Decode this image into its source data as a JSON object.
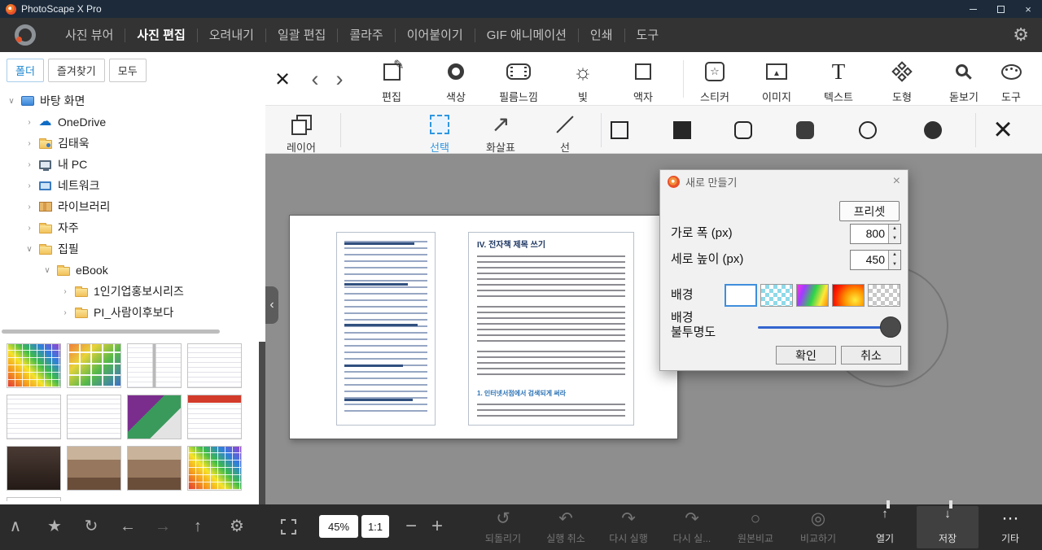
{
  "titlebar": {
    "title": "PhotoScape X Pro"
  },
  "icons": {
    "close": "×",
    "back": "‹",
    "forward": "›",
    "pencil": "✎",
    "sun": "☼",
    "star_outline": "☆",
    "star": "★",
    "text_t": "T",
    "arrow_ne": "↗",
    "cloud": "☁",
    "chevron_up": "∧",
    "refresh": "↻",
    "arrow_left": "←",
    "arrow_right": "→",
    "arrow_up": "↑",
    "arrow_down": "↓",
    "gear": "⚙",
    "undo_full": "↺",
    "undo": "↶",
    "redo": "↷",
    "circle": "○",
    "circle_double": "◎",
    "more": "⋯",
    "spin_up": "▲",
    "spin_down": "▼",
    "minus": "−",
    "plus": "+",
    "mountain": "▲"
  },
  "menubar": {
    "items": [
      "사진 뷰어",
      "사진 편집",
      "오려내기",
      "일괄 편집",
      "콜라주",
      "이어붙이기",
      "GIF 애니메이션",
      "인쇄",
      "도구"
    ],
    "active_item": "사진 편집"
  },
  "sidebar": {
    "tabs": [
      "폴더",
      "즐겨찾기",
      "모두"
    ],
    "active_tab": "폴더",
    "tree": [
      {
        "chevron": "∨",
        "label": "바탕 화면"
      },
      {
        "chevron": "›",
        "label": "OneDrive"
      },
      {
        "chevron": "›",
        "label": "김태욱"
      },
      {
        "chevron": "›",
        "label": "내 PC"
      },
      {
        "chevron": "›",
        "label": "네트워크"
      },
      {
        "chevron": "›",
        "label": "라이브러리"
      },
      {
        "chevron": "›",
        "label": "자주"
      },
      {
        "chevron": "∨",
        "label": "집필"
      },
      {
        "chevron": "∨",
        "label": "eBook"
      },
      {
        "chevron": "›",
        "label": "1인기업홍보시리즈"
      },
      {
        "chevron": "›",
        "label": "PI_사람이후보다"
      }
    ],
    "thumbnails": [
      {
        "class": "thumb t-rainbow"
      },
      {
        "class": "thumb t-collage"
      },
      {
        "class": "thumb t-docpages"
      },
      {
        "class": "thumb t-doc"
      },
      {
        "class": "thumb t-doc"
      },
      {
        "class": "thumb t-doc"
      },
      {
        "class": "thumb t-slides"
      },
      {
        "class": "thumb t-reddoc"
      },
      {
        "class": "thumb t-photo-dark"
      },
      {
        "class": "thumb t-photo"
      },
      {
        "class": "thumb t-photo"
      },
      {
        "class": "thumb t-rainbow"
      },
      {
        "class": "thumb t-doc"
      }
    ]
  },
  "toolbar_main": {
    "items": [
      "편집",
      "색상",
      "필름느낌",
      "빛",
      "액자",
      "스티커",
      "이미지",
      "텍스트",
      "도형",
      "돋보기",
      "도구"
    ]
  },
  "toolbar_edit": {
    "layer": "레이어",
    "select": "선택",
    "arrow": "화살표",
    "line": "선"
  },
  "canvas": {
    "page_title": "IV. 전자책 제목 쓰기",
    "page_subheading": "1. 인터넷서점에서 검색되게 써라"
  },
  "dialog": {
    "title": "새로 만들기",
    "preset": "프리셋",
    "width_label": "가로 폭 (px)",
    "width_value": "800",
    "height_label": "세로 높이 (px)",
    "height_value": "450",
    "background_label": "배경",
    "opacity_label_line1": "배경",
    "opacity_label_line2": "불투명도",
    "ok": "확인",
    "cancel": "취소"
  },
  "bottombar": {
    "zoom": "45%",
    "ratio": "1:1",
    "history": [
      {
        "label": "되돌리기"
      },
      {
        "label": "실행 취소"
      },
      {
        "label": "다시 실행"
      },
      {
        "label": "다시 실..."
      },
      {
        "label": "원본비교"
      },
      {
        "label": "비교하기"
      }
    ],
    "open": "열기",
    "save": "저장",
    "more": "기타"
  }
}
